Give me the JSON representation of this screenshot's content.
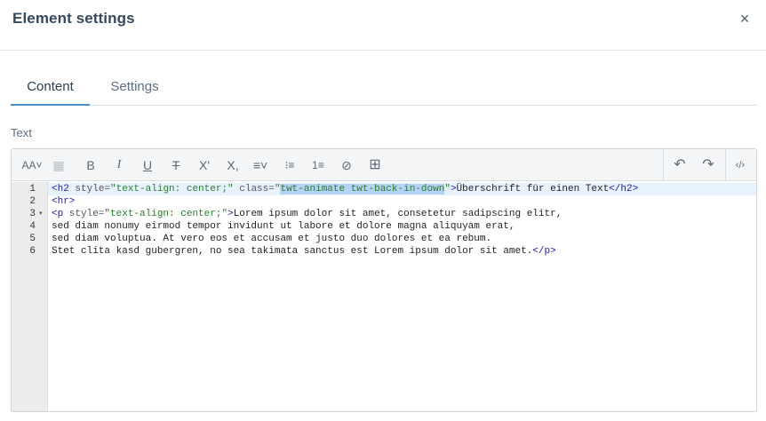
{
  "dialog": {
    "title": "Element settings",
    "close_label": "×"
  },
  "tabs": [
    {
      "label": "Content",
      "active": true
    },
    {
      "label": "Settings",
      "active": false
    }
  ],
  "field": {
    "label": "Text"
  },
  "toolbar": {
    "buttons": [
      {
        "name": "font-size-icon",
        "glyph": "AA˅"
      },
      {
        "name": "checker-icon",
        "glyph": "▦"
      },
      {
        "name": "bold-icon",
        "glyph": "B"
      },
      {
        "name": "italic-icon",
        "glyph": "I"
      },
      {
        "name": "underline-icon",
        "glyph": "U"
      },
      {
        "name": "strikethrough-icon",
        "glyph": "T"
      },
      {
        "name": "superscript-icon",
        "glyph": "X'"
      },
      {
        "name": "subscript-icon",
        "glyph": "X,"
      },
      {
        "name": "align-icon",
        "glyph": "≡˅"
      },
      {
        "name": "bullet-list-icon",
        "glyph": "⁝≡"
      },
      {
        "name": "numbered-list-icon",
        "glyph": "1≡"
      },
      {
        "name": "link-icon",
        "glyph": "⊘"
      },
      {
        "name": "table-icon",
        "glyph": "⊞"
      },
      {
        "name": "undo-icon",
        "glyph": "↶"
      },
      {
        "name": "redo-icon",
        "glyph": "↷"
      },
      {
        "name": "code-view-icon",
        "glyph": "‹/›"
      }
    ]
  },
  "code": {
    "line_numbers": [
      "1",
      "2",
      "3",
      "4",
      "5",
      "6"
    ],
    "fold_marker": "▾",
    "lines": [
      {
        "tag_open": "<h2",
        "attr1": " style=",
        "val1": "\"text-align: center;\"",
        "attr2": " class=",
        "q1": "\"",
        "selected": "twt-animate twt-back-in-down",
        "q2": "\"",
        "gt": ">",
        "text": "Überschrift für einen Text",
        "tag_close": "</h2>"
      },
      {
        "tag": "<hr>"
      },
      {
        "tag_open": "<p",
        "attr1": " style=",
        "val1": "\"text-align: center;\"",
        "gt": ">",
        "text": "Lorem ipsum dolor sit amet, consetetur sadipscing elitr,"
      },
      {
        "text": "sed diam nonumy eirmod tempor invidunt ut labore et dolore magna aliquyam erat,"
      },
      {
        "text": "sed diam voluptua. At vero eos et accusam et justo duo dolores et ea rebum."
      },
      {
        "text": "Stet clita kasd gubergren, no sea takimata sanctus est Lorem ipsum dolor sit amet.",
        "tag_close": "</p>"
      }
    ]
  }
}
